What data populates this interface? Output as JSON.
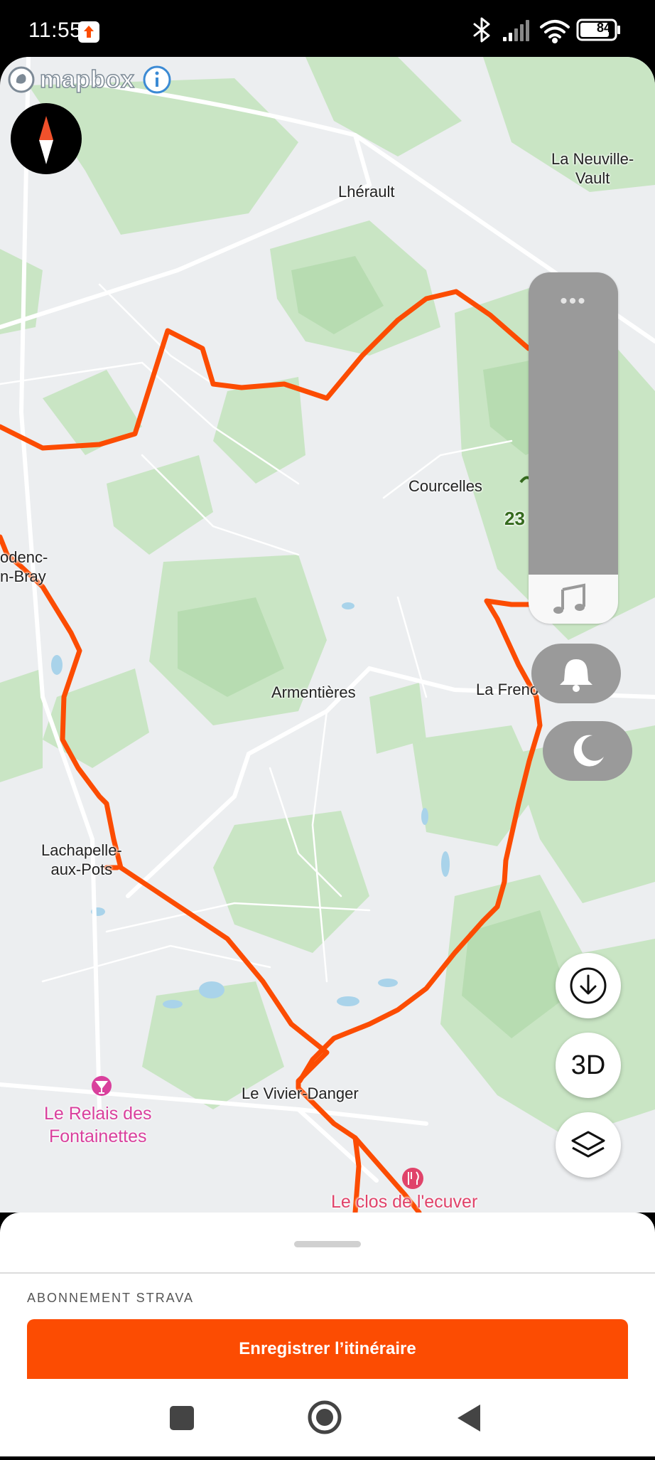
{
  "status_bar": {
    "time": "11:55",
    "battery": "84",
    "icons": [
      "app-notification-icon",
      "bluetooth-icon",
      "signal-icon",
      "wifi-icon",
      "battery-icon"
    ]
  },
  "map": {
    "attribution": "mapbox",
    "route_color": "#fc4c02",
    "places": [
      {
        "key": "lherault",
        "label": "Lhérault"
      },
      {
        "key": "la_neuville",
        "label": "La Neuville-\nVault"
      },
      {
        "key": "courcelles",
        "label": "Courcelles"
      },
      {
        "key": "odenc",
        "label": "odenc-\nn-Bray"
      },
      {
        "key": "armentieres",
        "label": "Armentières"
      },
      {
        "key": "la_frenoy",
        "label": "La Freno"
      },
      {
        "key": "lachapelle",
        "label": "Lachapelle-\naux-Pots"
      },
      {
        "key": "le_vivier",
        "label": "Le Vivier-Danger"
      }
    ],
    "pois": [
      {
        "key": "relais",
        "label": "Le Relais des\nFontainettes",
        "icon": "bar-icon"
      },
      {
        "key": "clos",
        "label": "Le clos de l'ecuver",
        "icon": "restaurant-icon"
      }
    ],
    "partial_badge": "23"
  },
  "controls": {
    "media_level": 0.14,
    "three_d_label": "3D",
    "icons": [
      "more-icon",
      "music-icon",
      "bell-icon",
      "moon-icon",
      "download-icon",
      "layers-icon",
      "compass-icon",
      "info-icon"
    ]
  },
  "sheet": {
    "subscription_label": "ABONNEMENT STRAVA",
    "cta_label": "Enregistrer l’itinéraire"
  },
  "nav_bar": {
    "icons": [
      "recents-icon",
      "home-icon",
      "back-icon"
    ]
  }
}
